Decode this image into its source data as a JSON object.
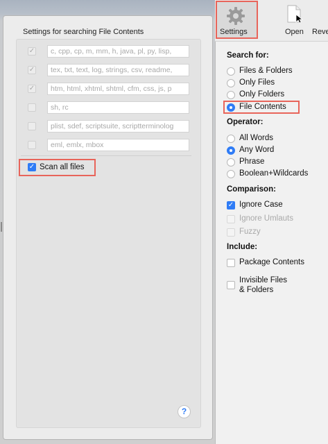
{
  "left": {
    "title": "Settings for searching File Contents",
    "extensions": [
      {
        "checked": true,
        "text": "c, cpp, cp, m, mm, h, java, pl, py, lisp,"
      },
      {
        "checked": true,
        "text": "tex, txt, text, log, strings, csv, readme,"
      },
      {
        "checked": true,
        "text": "htm, html, xhtml, shtml, cfm, css, js, p"
      },
      {
        "checked": false,
        "text": "sh, rc"
      },
      {
        "checked": false,
        "text": "plist, sdef, scriptsuite, scriptterminolog"
      },
      {
        "checked": false,
        "text": "eml, emlx, mbox"
      }
    ],
    "scan_all_files": {
      "label": "Scan all files",
      "checked": true
    },
    "help_label": "?"
  },
  "toolbar": {
    "settings_label": "Settings",
    "open_label": "Open",
    "reveal_label": "Reve"
  },
  "search_for": {
    "heading": "Search for:",
    "options": [
      {
        "label": "Files & Folders",
        "selected": false
      },
      {
        "label": "Only Files",
        "selected": false
      },
      {
        "label": "Only Folders",
        "selected": false
      },
      {
        "label": "File Contents",
        "selected": true
      }
    ]
  },
  "operator": {
    "heading": "Operator:",
    "options": [
      {
        "label": "All Words",
        "selected": false
      },
      {
        "label": "Any Word",
        "selected": true
      },
      {
        "label": "Phrase",
        "selected": false
      },
      {
        "label": "Boolean+Wildcards",
        "selected": false
      }
    ]
  },
  "comparison": {
    "heading": "Comparison:",
    "options": [
      {
        "label": "Ignore Case",
        "checked": true,
        "enabled": true
      },
      {
        "label": "Ignore Umlauts",
        "checked": false,
        "enabled": false
      },
      {
        "label": "Fuzzy",
        "checked": false,
        "enabled": false
      }
    ]
  },
  "include": {
    "heading": "Include:",
    "options": [
      {
        "label": "Package Contents",
        "checked": false
      },
      {
        "label": "Invisible Files",
        "label2": "& Folders",
        "checked": false
      }
    ]
  },
  "colors": {
    "accent": "#2f7cf6",
    "highlight": "#e8645a"
  }
}
